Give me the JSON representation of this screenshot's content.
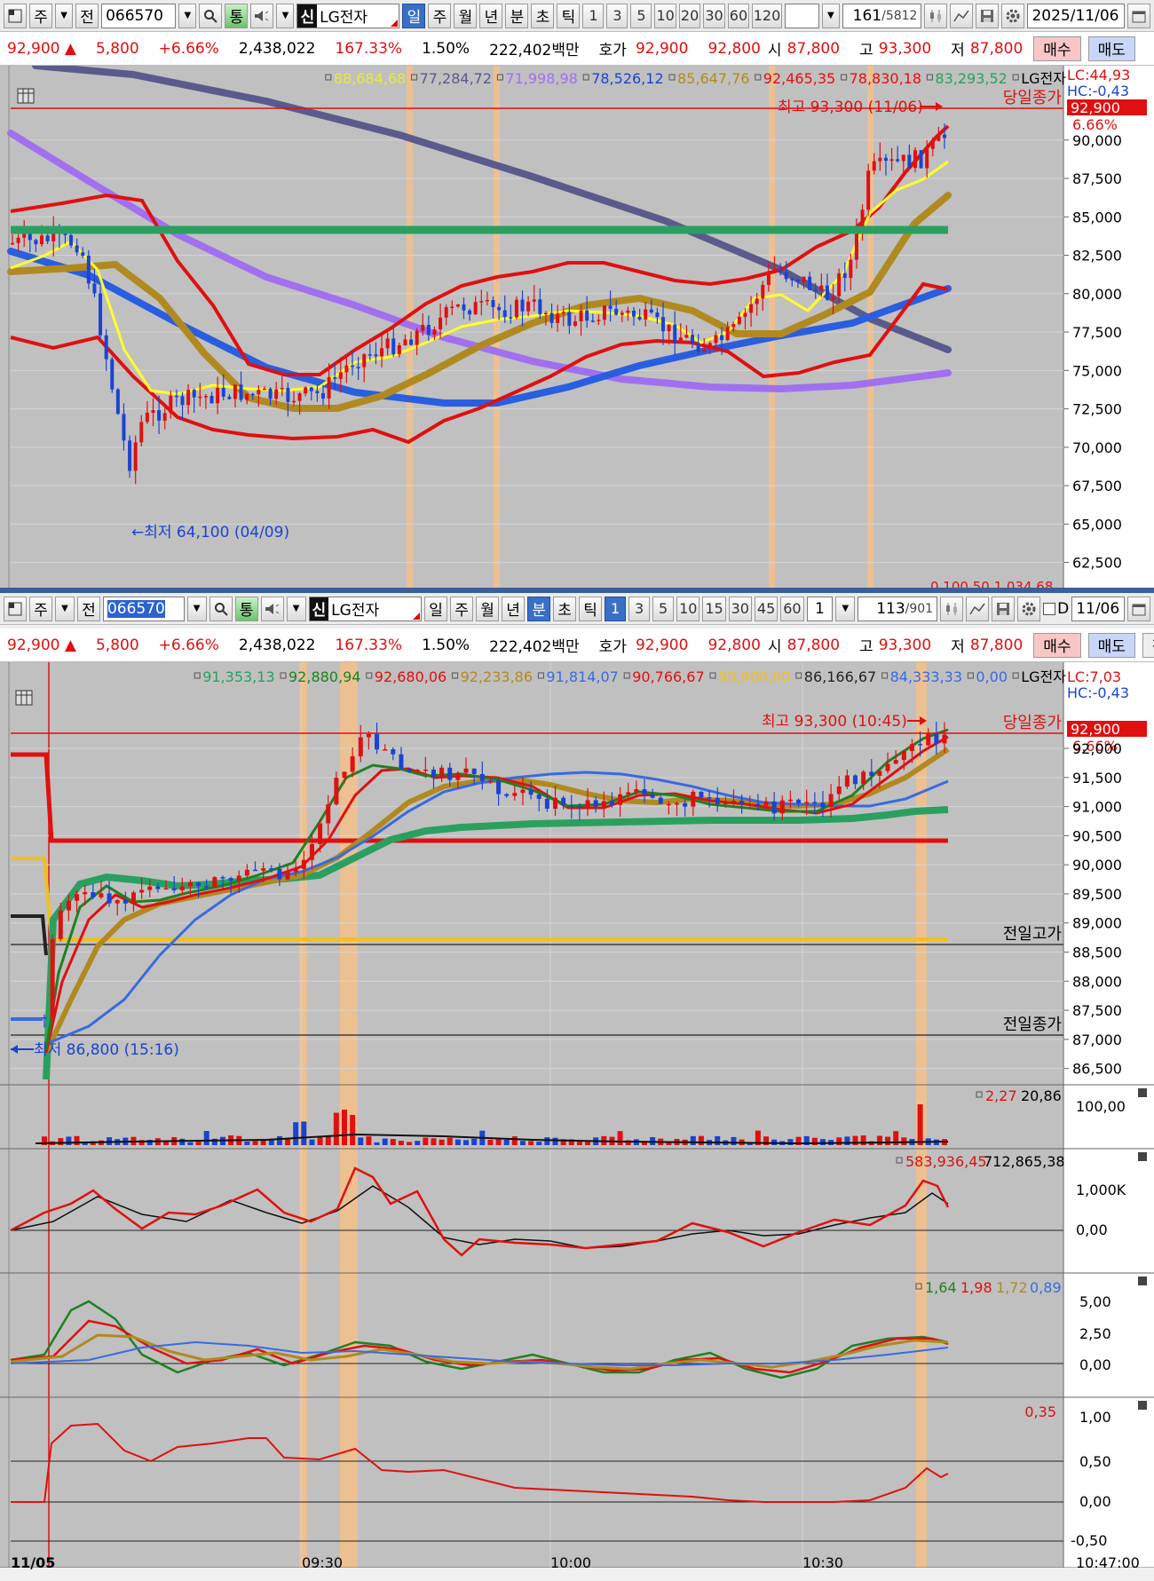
{
  "colors": {
    "up": "#e01010",
    "down": "#1a44d0",
    "bg": "#c0c0c0",
    "axis_bg": "#ffffff",
    "highlight": "#f4c08a",
    "separator": "#3c5e9a"
  },
  "top": {
    "toolbar": {
      "period_selected": "주",
      "code": "066570",
      "type_label": "전",
      "sin_label": "신",
      "name": "LG전자",
      "chk_label": "통",
      "period_tabs": [
        "일",
        "주",
        "월",
        "년",
        "분",
        "초",
        "틱"
      ],
      "selected_tab": "일",
      "intervals": [
        "1",
        "3",
        "5",
        "10",
        "20",
        "30",
        "60",
        "120"
      ],
      "count": "161",
      "total": "/5812",
      "date": "2025/11/06"
    },
    "quote": {
      "price": "92,900",
      "arrow": "▲",
      "change": "5,800",
      "change_pct": "+6.66%",
      "volume": "2,438,022",
      "vol_ratio": "167.33%",
      "turnover": "1.50%",
      "amount": "222,402백만",
      "hoga_label": "호가",
      "ask": "92,900",
      "bid": "92,800",
      "open_label": "시",
      "open": "87,800",
      "high_label": "고",
      "high": "93,300",
      "low_label": "저",
      "low": "87,800",
      "buy_label": "매수",
      "sell_label": "매도"
    },
    "legend": [
      {
        "text": "88,684,68",
        "color": "#e8e840"
      },
      {
        "text": "77,284,72",
        "color": "#5a5a8c"
      },
      {
        "text": "71,998,98",
        "color": "#a070f0"
      },
      {
        "text": "78,526,12",
        "color": "#1a44d0"
      },
      {
        "text": "85,647,76",
        "color": "#b08a20"
      },
      {
        "text": "92,465,35",
        "color": "#e01010"
      },
      {
        "text": "78,830,18",
        "color": "#e01010"
      },
      {
        "text": "83,293,52",
        "color": "#2aa060"
      },
      {
        "text": "LG전자",
        "color": "#000000"
      }
    ],
    "lc": "LC:44,93",
    "hc": "HC:-0,43",
    "close_label": "당일종가",
    "price_tag": "92,900",
    "pct_tag": "6.66%",
    "high_note": "최고 93,300 (11/06)",
    "low_note": "←최저 64,100 (04/09)",
    "bottom_cut": "0,100,50   1,034,68",
    "y_ticks": [
      "90,000",
      "87,500",
      "85,000",
      "82,500",
      "80,000",
      "77,500",
      "75,000",
      "72,500",
      "70,000",
      "67,500",
      "65,000",
      "62,500"
    ],
    "y_values": [
      90000,
      87500,
      85000,
      82500,
      80000,
      77500,
      75000,
      72500,
      70000,
      67500,
      65000,
      62500
    ],
    "chart_data": {
      "type": "candlestick",
      "ylim": [
        60860,
        94840
      ],
      "high": 93300,
      "low": 64100,
      "close": 92900,
      "support": 83293.52
    }
  },
  "bottom": {
    "toolbar": {
      "period_selected": "주",
      "code": "066570",
      "type_label": "전",
      "sin_label": "신",
      "name": "LG전자",
      "chk_label": "통",
      "period_tabs": [
        "일",
        "주",
        "월",
        "년",
        "분",
        "초",
        "틱"
      ],
      "selected_tab": "분",
      "intervals": [
        "1",
        "3",
        "5",
        "10",
        "15",
        "30",
        "45",
        "60"
      ],
      "selected_interval": "1",
      "mult": "1",
      "count": "113",
      "total": "/901",
      "d_label": "D",
      "date": "11/06"
    },
    "quote": {
      "price": "92,900",
      "arrow": "▲",
      "change": "5,800",
      "change_pct": "+6.66%",
      "volume": "2,438,022",
      "vol_ratio": "167.33%",
      "turnover": "1.50%",
      "amount": "222,402백만",
      "hoga_label": "호가",
      "ask": "92,900",
      "bid": "92,800",
      "open_label": "시",
      "open": "87,800",
      "high_label": "고",
      "high": "93,300",
      "low_label": "저",
      "low": "87,800",
      "buy_label": "매수",
      "sell_label": "매도",
      "flat_label": "평"
    },
    "legend": [
      {
        "text": "91,353,13",
        "color": "#2aa060"
      },
      {
        "text": "92,880,94",
        "color": "#208020"
      },
      {
        "text": "92,680,06",
        "color": "#e01010"
      },
      {
        "text": "92,233,86",
        "color": "#b08a20"
      },
      {
        "text": "91,814,07",
        "color": "#3a6ae0"
      },
      {
        "text": "90,766,67",
        "color": "#e01010"
      },
      {
        "text": "90,900,00",
        "color": "#f0c020"
      },
      {
        "text": "86,166,67",
        "color": "#222222"
      },
      {
        "text": "84,333,33",
        "color": "#3a6ae0"
      },
      {
        "text": "0,00",
        "color": "#3a6ae0"
      },
      {
        "text": "LG전자",
        "color": "#000000"
      }
    ],
    "lc": "LC:7,03",
    "hc": "HC:-0,43",
    "close_label": "당일종가",
    "price_tag": "92,900",
    "pct_tag": "6.66%",
    "high_note": "최고 93,300 (10:45)",
    "low_note": "최저 86,800 (15:16)",
    "prev_high_label": "전일고가",
    "prev_close_label": "전일종가",
    "y_ticks": [
      "92,000",
      "91,500",
      "91,000",
      "90,500",
      "90,000",
      "89,500",
      "89,000",
      "88,500",
      "88,000",
      "87,500",
      "87,000",
      "86,500"
    ],
    "y_values": [
      92000,
      91500,
      91000,
      90500,
      90000,
      89500,
      89000,
      88500,
      88000,
      87500,
      87000,
      86500
    ],
    "chart_data": {
      "type": "candlestick",
      "ylim": [
        86220,
        93480
      ],
      "prev_high": 88900,
      "prev_close": 87100
    },
    "volume": {
      "legend_a": "2,27",
      "legend_b": "20,86",
      "tick": "100,00"
    },
    "osc1": {
      "legend_a": "583,936,45",
      "legend_b": "712,865,38",
      "ticks": [
        "1,000K",
        "0,00"
      ]
    },
    "osc2": {
      "legend": [
        "1,64",
        "1,98",
        "1,72",
        "0,89"
      ],
      "ticks": [
        "5,00",
        "2,50",
        "0,00"
      ]
    },
    "osc3": {
      "legend": "0,35",
      "ticks": [
        "1,00",
        "0,50",
        "0,00",
        "-0,50"
      ]
    },
    "x_ticks": [
      "11/05",
      "09:30",
      "10:00",
      "10:30",
      "10:47:00"
    ]
  }
}
